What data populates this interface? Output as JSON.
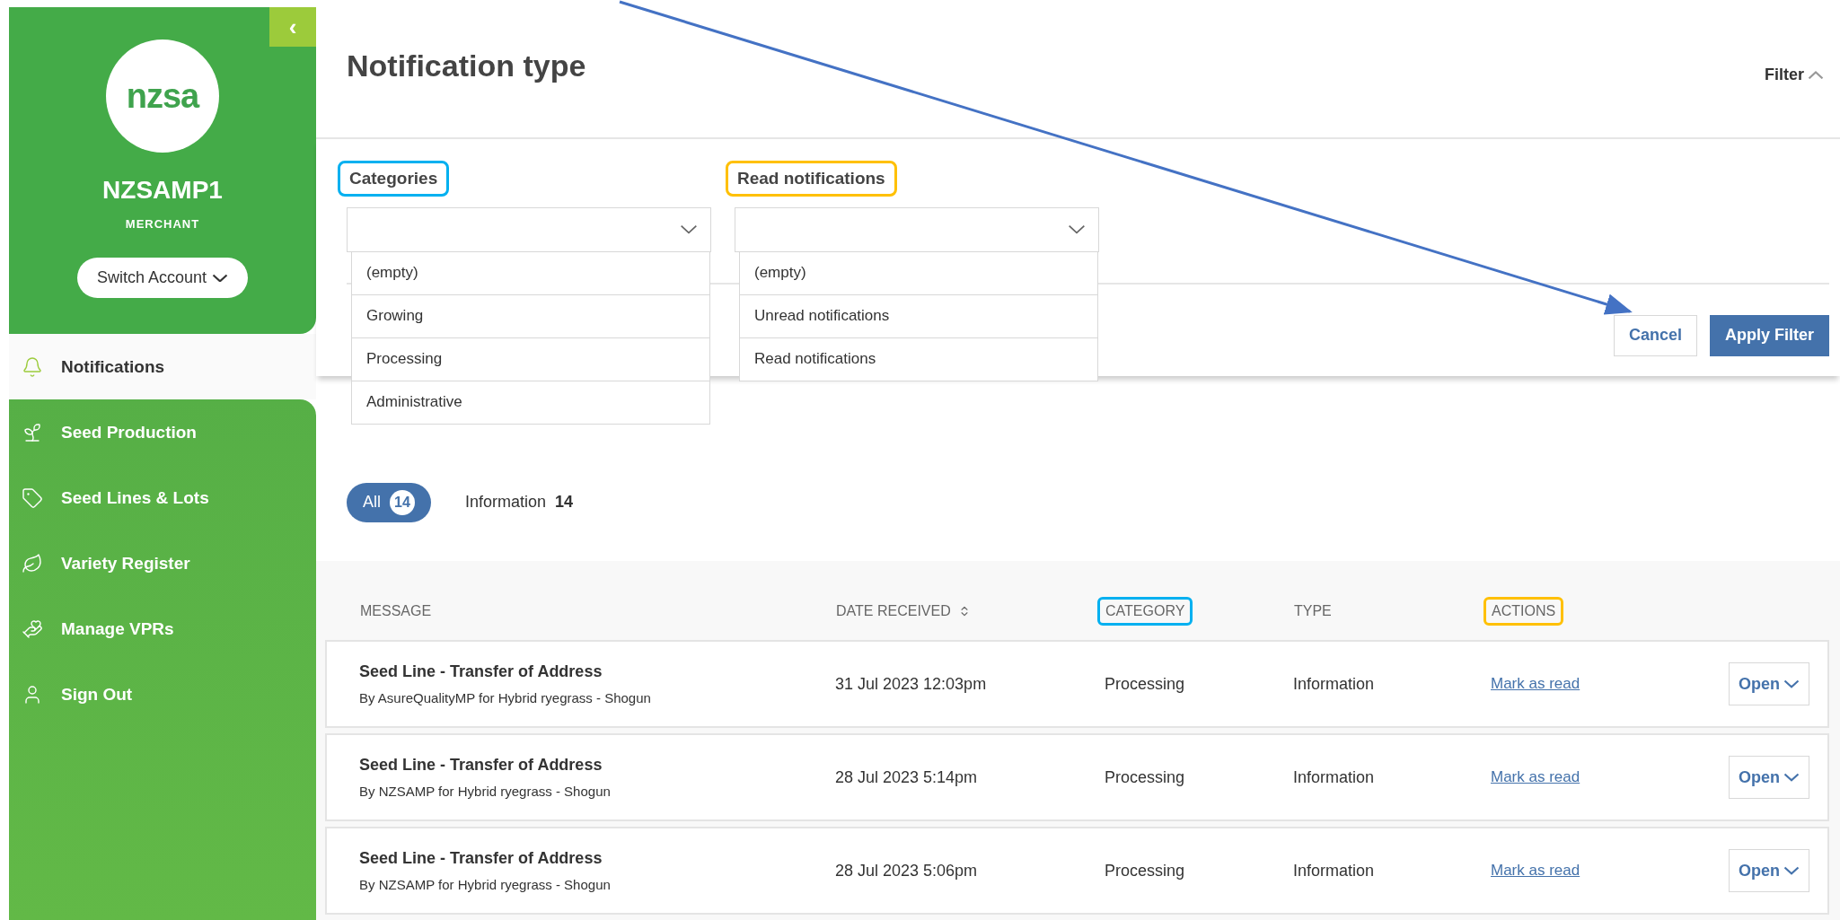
{
  "sidebar": {
    "collapse_icon": "‹",
    "logo_text": "nzsa",
    "account": {
      "name": "NZSAMP1",
      "role": "MERCHANT",
      "switch_label": "Switch Account"
    },
    "items": [
      {
        "label": "Notifications",
        "selected": true
      },
      {
        "label": "Seed Production",
        "selected": false
      },
      {
        "label": "Seed Lines & Lots",
        "selected": false
      },
      {
        "label": "Variety Register",
        "selected": false
      },
      {
        "label": "Manage VPRs",
        "selected": false
      },
      {
        "label": "Sign Out",
        "selected": false
      }
    ]
  },
  "header": {
    "title": "Notification type",
    "filter_toggle": "Filter",
    "filter_expanded": true
  },
  "filters": [
    {
      "label": "Categories",
      "color": "#00b0f0",
      "expanded": true,
      "options": [
        "(empty)",
        "Growing",
        "Processing",
        "Administrative"
      ]
    },
    {
      "label": "Read notifications",
      "color": "#ffc000",
      "expanded": true,
      "options": [
        "(empty)",
        "Unread notifications",
        "Read notifications"
      ]
    }
  ],
  "filter_buttons": [
    {
      "label": "Cancel",
      "kind": "secondary"
    },
    {
      "label": "Apply Filter",
      "kind": "primary"
    }
  ],
  "pills": [
    {
      "label": "All",
      "count": "14",
      "selected": true
    },
    {
      "label": "Information",
      "count": "14",
      "selected": false
    }
  ],
  "table": {
    "columns": [
      {
        "label": "MESSAGE",
        "sortable": false
      },
      {
        "label": "DATE RECEIVED",
        "sortable": true
      },
      {
        "label": "CATEGORY",
        "sortable": false,
        "color": "#00b0f0"
      },
      {
        "label": "TYPE",
        "sortable": false
      },
      {
        "label": "ACTIONS",
        "sortable": false,
        "color": "#ffc000"
      }
    ],
    "rows": [
      {
        "title": "Seed Line - Transfer of Address",
        "subtitle": "By AsureQualityMP for Hybrid ryegrass - Shogun",
        "date": "31 Jul 2023 12:03pm",
        "category": "Processing",
        "type": "Information",
        "action": "Mark as read",
        "open": "Open"
      },
      {
        "title": "Seed Line - Transfer of Address",
        "subtitle": "By NZSAMP for Hybrid ryegrass - Shogun",
        "date": "28 Jul 2023 5:14pm",
        "category": "Processing",
        "type": "Information",
        "action": "Mark as read",
        "open": "Open"
      },
      {
        "title": "Seed Line - Transfer of Address",
        "subtitle": "By NZSAMP for Hybrid ryegrass - Shogun",
        "date": "28 Jul 2023 5:06pm",
        "category": "Processing",
        "type": "Information",
        "action": "Mark as read",
        "open": "Open"
      }
    ]
  }
}
